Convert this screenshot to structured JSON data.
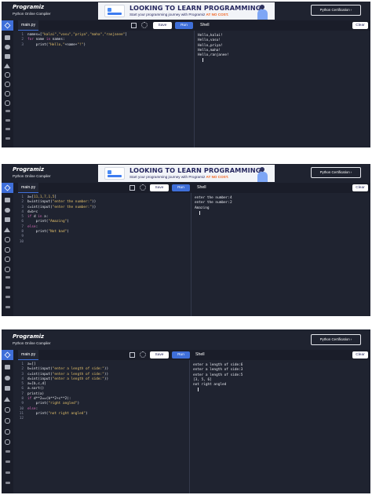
{
  "app": {
    "logo": "Programiz",
    "subtitle": "Python Online Compiler",
    "certification_button": "Python Certification ›"
  },
  "ad": {
    "title": "LOOKING TO LEARN PROGRAMMING?",
    "line_prefix": "Start your programming journey with Programiz ",
    "line_highlight": "AT NO COST."
  },
  "toolbar": {
    "file_tab": "main.py",
    "save_label": "Save",
    "run_label": "Run",
    "shell_label": "Shell",
    "clear_label": "Clear"
  },
  "panels": [
    {
      "has_ad": true,
      "code": [
        [
          {
            "t": "names=[",
            "c": ""
          },
          {
            "t": "\"kalai\",\"vasu\",\"priya\",\"maha\",\"ranjanee\"",
            "c": "str"
          },
          {
            "t": "]",
            "c": ""
          }
        ],
        [
          {
            "t": "for",
            "c": "kw"
          },
          {
            "t": " name ",
            "c": ""
          },
          {
            "t": "in",
            "c": "kw"
          },
          {
            "t": " names:",
            "c": ""
          }
        ],
        [
          {
            "t": "    print(",
            "c": ""
          },
          {
            "t": "\"Hello,\"",
            "c": "str"
          },
          {
            "t": "+name+",
            "c": ""
          },
          {
            "t": "\"!\"",
            "c": "str"
          },
          {
            "t": ")",
            "c": ""
          }
        ]
      ],
      "output": [
        "Hello,kalai!",
        "Hello,vasu!",
        "Hello,priya!",
        "Hello,maha!",
        "Hello,ranjanee!"
      ]
    },
    {
      "has_ad": true,
      "code": [
        [
          {
            "t": "a=[",
            "c": ""
          },
          {
            "t": "11,1,7,1,5",
            "c": "str"
          },
          {
            "t": "]",
            "c": ""
          }
        ],
        [
          {
            "t": "b=int(input(",
            "c": ""
          },
          {
            "t": "\"enter the number:\"",
            "c": "str"
          },
          {
            "t": "))",
            "c": ""
          }
        ],
        [
          {
            "t": "c=int(input(",
            "c": ""
          },
          {
            "t": "\"enter the number:\"",
            "c": "str"
          },
          {
            "t": "))",
            "c": ""
          }
        ],
        [
          {
            "t": "d=b+c",
            "c": ""
          }
        ],
        [
          {
            "t": "if",
            "c": "kw"
          },
          {
            "t": " d ",
            "c": ""
          },
          {
            "t": "in",
            "c": "kw"
          },
          {
            "t": " a:",
            "c": ""
          }
        ],
        [
          {
            "t": "    print(",
            "c": ""
          },
          {
            "t": "\"Amazing\"",
            "c": "str"
          },
          {
            "t": ")",
            "c": ""
          }
        ],
        [
          {
            "t": "else",
            "c": "kw"
          },
          {
            "t": ":",
            "c": ""
          }
        ],
        [
          {
            "t": "    print(",
            "c": ""
          },
          {
            "t": "\"Not bad\"",
            "c": "str"
          },
          {
            "t": ")",
            "c": ""
          }
        ],
        [
          {
            "t": "",
            "c": ""
          }
        ],
        [
          {
            "t": "",
            "c": ""
          }
        ]
      ],
      "output": [
        "enter the number:4",
        "enter the number:2",
        "Amazing"
      ]
    },
    {
      "has_ad": false,
      "code": [
        [
          {
            "t": "a=[]",
            "c": ""
          }
        ],
        [
          {
            "t": "b=int(input(",
            "c": ""
          },
          {
            "t": "\"enter a length of side:\"",
            "c": "str"
          },
          {
            "t": "))",
            "c": ""
          }
        ],
        [
          {
            "t": "c=int(input(",
            "c": ""
          },
          {
            "t": "\"enter a length of side:\"",
            "c": "str"
          },
          {
            "t": "))",
            "c": ""
          }
        ],
        [
          {
            "t": "d=int(input(",
            "c": ""
          },
          {
            "t": "\"enter a length of side:\"",
            "c": "str"
          },
          {
            "t": "))",
            "c": ""
          }
        ],
        [
          {
            "t": "a=[b,c,d]",
            "c": ""
          }
        ],
        [
          {
            "t": "a.sort()",
            "c": ""
          }
        ],
        [
          {
            "t": "print(a)",
            "c": ""
          }
        ],
        [
          {
            "t": "if",
            "c": "kw"
          },
          {
            "t": " d**2==(b**2+c**2):",
            "c": ""
          }
        ],
        [
          {
            "t": "    print(",
            "c": ""
          },
          {
            "t": "\"right angled\"",
            "c": "str"
          },
          {
            "t": ")",
            "c": ""
          }
        ],
        [
          {
            "t": "else",
            "c": "kw"
          },
          {
            "t": ":",
            "c": ""
          }
        ],
        [
          {
            "t": "    print(",
            "c": ""
          },
          {
            "t": "\"not right angled\"",
            "c": "str"
          },
          {
            "t": ")",
            "c": ""
          }
        ],
        [
          {
            "t": "",
            "c": ""
          }
        ]
      ],
      "output": [
        "enter a length of side:6",
        "enter a length of side:3",
        "enter a length of side:5",
        "[3, 5, 6]",
        "not right angled"
      ]
    }
  ]
}
